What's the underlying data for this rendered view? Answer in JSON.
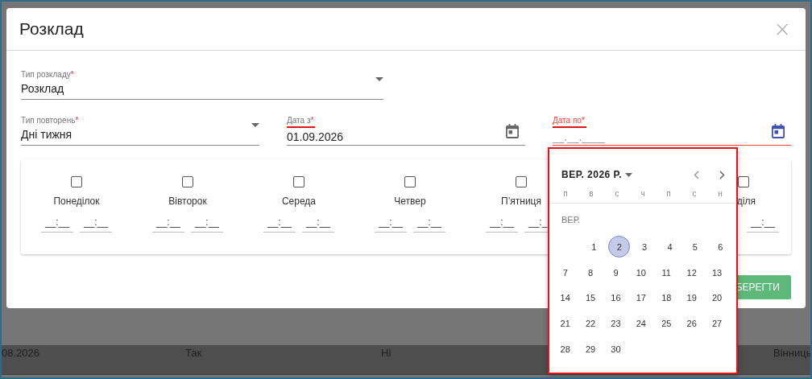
{
  "dialog": {
    "title": "Розклад",
    "close": "×"
  },
  "schedule_type": {
    "label": "Тип розкладу",
    "mark": "*",
    "value": "Розклад"
  },
  "repeat_type": {
    "label": "Тип повторень",
    "mark": "*",
    "value": "Дні тижня"
  },
  "date_from": {
    "label": "Дата з",
    "mark": "*",
    "value": "01.09.2026",
    "error": false,
    "highlighted": true,
    "active": false
  },
  "date_to": {
    "label": "Дата по",
    "mark": "*",
    "placeholder": "__.__.____",
    "error": true,
    "highlighted": true,
    "active": true
  },
  "days": [
    {
      "label": "Понеділок",
      "checked": false,
      "times": [
        "__:__",
        "__:__"
      ]
    },
    {
      "label": "Вівторок",
      "checked": false,
      "times": [
        "__:__",
        "__:__"
      ]
    },
    {
      "label": "Середа",
      "checked": false,
      "times": [
        "__:__",
        "__:__"
      ]
    },
    {
      "label": "Четвер",
      "checked": false,
      "times": [
        "__:__",
        "__:__"
      ]
    },
    {
      "label": "П’ятниця",
      "checked": false,
      "times": [
        "__:__",
        "__:_"
      ]
    },
    {
      "label": "діля",
      "checked": false,
      "times": [
        "__:__"
      ]
    }
  ],
  "save_button": "БЕРЕГТИ",
  "background_row": [
    "08.2026",
    "Так",
    "Ні",
    "Вінниць"
  ],
  "calendar": {
    "highlighted": true,
    "title": "ВЕР. 2026 Р.",
    "weekdays": [
      "п",
      "в",
      "с",
      "ч",
      "п",
      "с",
      "н"
    ],
    "month_label": "ВЕР.",
    "weeks": [
      {
        "days": [
          {
            "label": "1",
            "selected": false
          },
          {
            "label": "2",
            "selected": true
          },
          {
            "label": "3",
            "selected": false
          },
          {
            "label": "4",
            "selected": false
          },
          {
            "label": "5",
            "selected": false
          },
          {
            "label": "6",
            "selected": false
          }
        ]
      },
      {
        "days": [
          {
            "label": "7",
            "selected": false
          },
          {
            "label": "8",
            "selected": false
          },
          {
            "label": "9",
            "selected": false
          },
          {
            "label": "10",
            "selected": false
          },
          {
            "label": "11",
            "selected": false
          },
          {
            "label": "12",
            "selected": false
          },
          {
            "label": "13",
            "selected": false
          }
        ]
      },
      {
        "days": [
          {
            "label": "14",
            "selected": false
          },
          {
            "label": "15",
            "selected": false
          },
          {
            "label": "16",
            "selected": false
          },
          {
            "label": "17",
            "selected": false
          },
          {
            "label": "18",
            "selected": false
          },
          {
            "label": "19",
            "selected": false
          },
          {
            "label": "20",
            "selected": false
          }
        ]
      },
      {
        "days": [
          {
            "label": "21",
            "selected": false
          },
          {
            "label": "22",
            "selected": false
          },
          {
            "label": "23",
            "selected": false
          },
          {
            "label": "24",
            "selected": false
          },
          {
            "label": "25",
            "selected": false
          },
          {
            "label": "26",
            "selected": false
          },
          {
            "label": "27",
            "selected": false
          }
        ]
      },
      {
        "days": [
          {
            "label": "28",
            "selected": false
          },
          {
            "label": "29",
            "selected": false
          },
          {
            "label": "30",
            "selected": false
          }
        ]
      }
    ]
  }
}
